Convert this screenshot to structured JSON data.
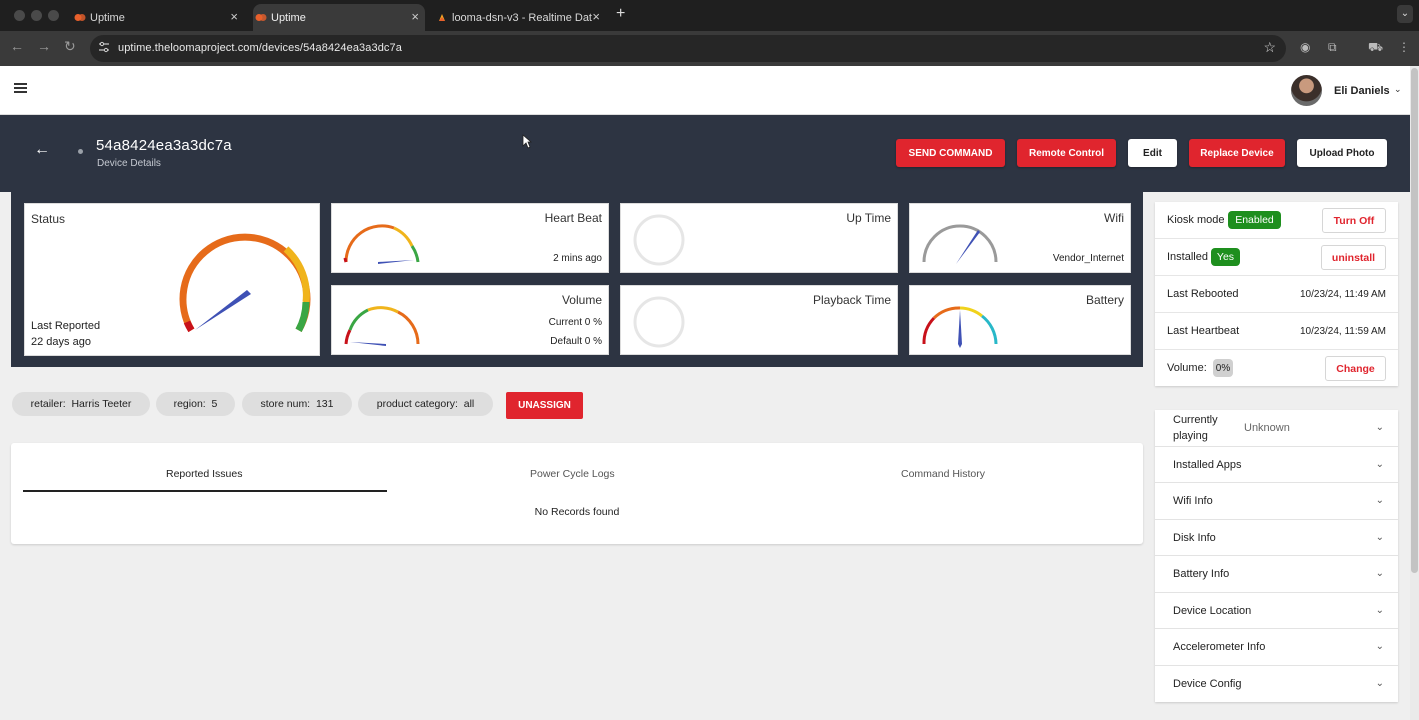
{
  "browser": {
    "tabs": [
      {
        "label": "Uptime",
        "active": false
      },
      {
        "label": "Uptime",
        "active": true
      },
      {
        "label": "looma-dsn-v3 - Realtime Dat",
        "active": false
      }
    ],
    "url": "uptime.theloomaproject.com/devices/54a8424ea3a3dc7a"
  },
  "header": {
    "user_name": "Eli Daniels"
  },
  "device": {
    "id": "54a8424ea3a3dc7a",
    "subtitle": "Device Details"
  },
  "actions": {
    "send_command": "SEND COMMAND",
    "remote_control": "Remote Control",
    "edit": "Edit",
    "replace_device": "Replace Device",
    "upload_photo": "Upload Photo"
  },
  "gauges": {
    "status": {
      "title": "Status",
      "last_reported_label": "Last Reported",
      "last_reported_value": "22 days ago"
    },
    "heart_beat": {
      "title": "Heart Beat",
      "value": "2 mins ago"
    },
    "up_time": {
      "title": "Up Time"
    },
    "wifi": {
      "title": "Wifi",
      "value": "Vendor_Internet"
    },
    "volume": {
      "title": "Volume",
      "current": "Current 0 %",
      "default": "Default 0 %"
    },
    "playback_time": {
      "title": "Playback Time"
    },
    "battery": {
      "title": "Battery"
    }
  },
  "chips": [
    {
      "key": "retailer:",
      "value": "Harris Teeter"
    },
    {
      "key": "region:",
      "value": "5"
    },
    {
      "key": "store num:",
      "value": "131"
    },
    {
      "key": "product category:",
      "value": "all"
    }
  ],
  "unassign_label": "UNASSIGN",
  "panel_tabs": {
    "tabs": [
      "Reported Issues",
      "Power Cycle Logs",
      "Command History"
    ],
    "active": "Reported Issues",
    "empty_message": "No Records found"
  },
  "device_status": {
    "kiosk_label": "Kiosk mode",
    "kiosk_value": "Enabled",
    "kiosk_action": "Turn Off",
    "installed_label": "Installed",
    "installed_value": "Yes",
    "installed_action": "uninstall",
    "last_rebooted_label": "Last Rebooted",
    "last_rebooted_value": "10/23/24, 11:49 AM",
    "last_heartbeat_label": "Last Heartbeat",
    "last_heartbeat_value": "10/23/24, 11:59 AM",
    "volume_label": "Volume:",
    "volume_value": "0%",
    "volume_action": "Change"
  },
  "accordion": {
    "currently_playing_label_1": "Currently",
    "currently_playing_label_2": "playing",
    "currently_playing_value": "Unknown",
    "items": [
      "Installed Apps",
      "Wifi Info",
      "Disk Info",
      "Battery Info",
      "Device Location",
      "Accelerometer Info",
      "Device Config"
    ]
  },
  "colors": {
    "accent_red": "#e0252e",
    "banner": "#2d3442",
    "badge_green": "#1e8f1e"
  }
}
